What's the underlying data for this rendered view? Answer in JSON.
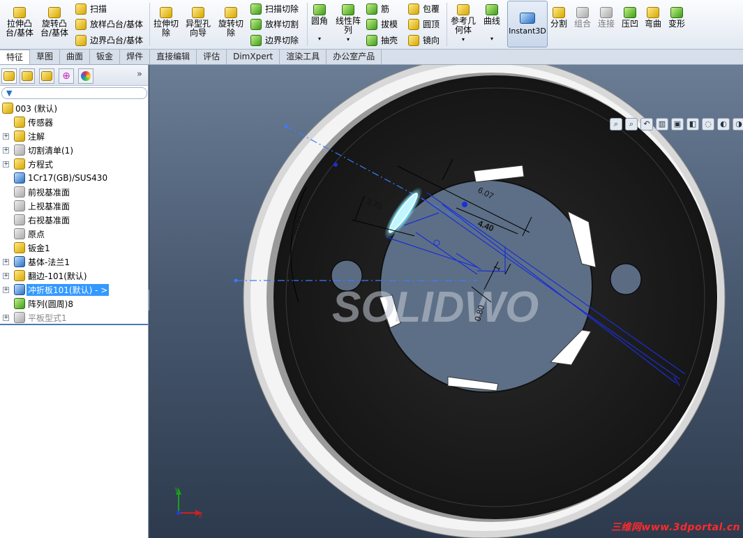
{
  "ribbon": {
    "extrude_boss": "拉伸凸\n台/基体",
    "revolve_boss": "旋转凸\n台/基体",
    "sweep": "扫描",
    "loft_boss": "放样凸台/基体",
    "boundary_boss": "边界凸台/基体",
    "extrude_cut": "拉伸切\n除",
    "hole_wizard": "异型孔\n向导",
    "revolve_cut": "旋转切\n除",
    "sweep_cut": "扫描切除",
    "loft_cut": "放样切割",
    "boundary_cut": "边界切除",
    "fillet": "圆角",
    "linear_pattern": "线性阵\n列",
    "rib": "筋",
    "draft": "拔模",
    "shell": "抽壳",
    "wrap": "包覆",
    "dome": "圆顶",
    "mirror": "镜向",
    "reference_geometry": "参考几\n何体",
    "curves": "曲线",
    "instant3d": "Instant3D",
    "split": "分割",
    "combine": "组合",
    "join": "连接",
    "indent": "压凹",
    "flex": "弯曲",
    "deform": "变形"
  },
  "tabs": [
    "特征",
    "草图",
    "曲面",
    "钣金",
    "焊件",
    "直接编辑",
    "评估",
    "DimXpert",
    "渲染工具",
    "办公室产品"
  ],
  "active_tab": "特征",
  "tree": {
    "root": "003 (默认)",
    "items": [
      {
        "label": "传感器",
        "expandable": false
      },
      {
        "label": "注解",
        "expandable": true
      },
      {
        "label": "切割清单(1)",
        "expandable": true
      },
      {
        "label": "方程式",
        "expandable": true
      },
      {
        "label": "1Cr17(GB)/SUS430",
        "expandable": false
      },
      {
        "label": "前视基准面",
        "expandable": false
      },
      {
        "label": "上视基准面",
        "expandable": false
      },
      {
        "label": "右视基准面",
        "expandable": false
      },
      {
        "label": "原点",
        "expandable": false
      },
      {
        "label": "钣金1",
        "expandable": false
      },
      {
        "label": "基体-法兰1",
        "expandable": true
      },
      {
        "label": "翻边-101(默认)",
        "expandable": true
      },
      {
        "label": "冲折板101(默认) - >",
        "expandable": true
      },
      {
        "label": "阵列(圆周)8",
        "expandable": false
      },
      {
        "label": "平板型式1",
        "expandable": true
      }
    ]
  },
  "viewport": {
    "dimensions": [
      "6.07",
      "4.40",
      "3.70",
      "37.51°",
      "0.80",
      "1"
    ],
    "watermark_logo": "SOLIDWO",
    "site_watermark": "三维网www.3dportal.cn",
    "triad_labels": [
      "X",
      "Y"
    ]
  },
  "colors": {
    "selection_blue": "#3399ff",
    "sketch_blue": "#1a2fd6",
    "highlight_cyan": "#7fe8ff",
    "watermark_red": "#ff2a2a"
  },
  "icons": {
    "panel_tabs": [
      "feature-manager-icon",
      "property-manager-icon",
      "configuration-manager-icon",
      "dimxpert-manager-icon",
      "display-manager-icon"
    ]
  }
}
